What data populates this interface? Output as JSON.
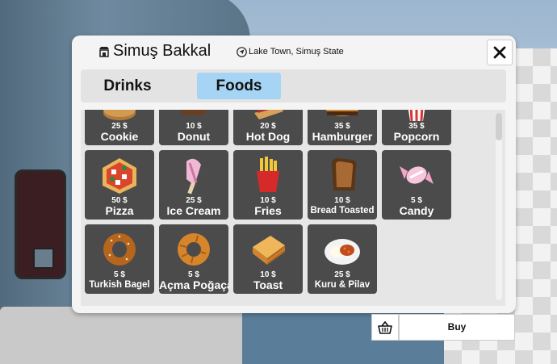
{
  "header": {
    "shop_name": "Simuş Bakkal",
    "location": "Lake Town, Simuş State"
  },
  "tabs": [
    {
      "label": "Drinks",
      "active": false
    },
    {
      "label": "Foods",
      "active": true
    }
  ],
  "colors": {
    "active_tab": "#a6d4f5",
    "tile": "#4b4b4b",
    "panel": "#f4f4f4"
  },
  "items": [
    {
      "name": "Cookie",
      "price": "25 $",
      "icon": "cookie-icon"
    },
    {
      "name": "Donut",
      "price": "10 $",
      "icon": "donut-icon"
    },
    {
      "name": "Hot Dog",
      "price": "20 $",
      "icon": "hot-dog-icon"
    },
    {
      "name": "Hamburger",
      "price": "35 $",
      "icon": "hamburger-icon"
    },
    {
      "name": "Popcorn",
      "price": "35 $",
      "icon": "popcorn-icon"
    },
    {
      "name": "Pizza",
      "price": "50 $",
      "icon": "pizza-icon"
    },
    {
      "name": "Ice Cream",
      "price": "25 $",
      "icon": "ice-cream-icon"
    },
    {
      "name": "Fries",
      "price": "10 $",
      "icon": "fries-icon"
    },
    {
      "name": "Bread Toasted",
      "price": "10 $",
      "icon": "bread-toasted-icon"
    },
    {
      "name": "Candy",
      "price": "5 $",
      "icon": "candy-icon"
    },
    {
      "name": "Turkish Bagel",
      "price": "5 $",
      "icon": "turkish-bagel-icon"
    },
    {
      "name": "Açma Poğaça",
      "price": "5 $",
      "icon": "acma-icon"
    },
    {
      "name": "Toast",
      "price": "10 $",
      "icon": "toast-icon"
    },
    {
      "name": "Kuru & Pilav",
      "price": "25 $",
      "icon": "kuru-pilav-icon"
    }
  ],
  "footer": {
    "buy_label": "Buy"
  }
}
